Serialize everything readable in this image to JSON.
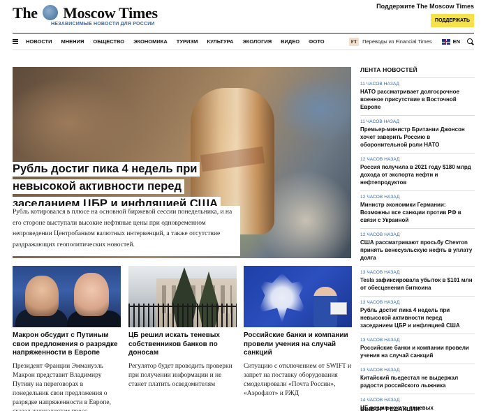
{
  "header": {
    "logo_text_left": "The",
    "logo_text_right": "Moscow Times",
    "logo_subtitle": "НЕЗАВИСИМЫЕ НОВОСТИ ДЛЯ РОССИИ",
    "support_title": "Поддержите The Moscow Times",
    "support_button": "ПОДДЕРЖАТЬ",
    "support_button_color": "#f5e14a"
  },
  "nav": {
    "items": [
      "НОВОСТИ",
      "МНЕНИЯ",
      "ОБЩЕСТВО",
      "ЭКОНОМИКА",
      "ТУРИЗМ",
      "КУЛЬТУРА",
      "ЭКОЛОГИЯ",
      "ВИДЕО",
      "ФОТО"
    ],
    "ft_badge": "FT",
    "ft_label": "Переводы из Financial Times",
    "lang": "EN"
  },
  "hero": {
    "title": "Рубль достиг пика 4 недель при невысокой активности перед заседанием ЦБР и инфляцией США",
    "lead": "Рубль котировался в плюсе на основной биржевой сессии понедельника, и на его стороне выступали высокие нефтяные цены при одновременном непроведении Центробанком валютных интервенций, а также отсутствие раздражающих геополитических новостей."
  },
  "cards": [
    {
      "title": "Макрон обсудит с Путиным свои предложения о разрядке напряженности в Европе",
      "lead": "Президент Франции Эммануэль Макрон представит Владимиру Путину на переговорах в понедельник свои предложения о разрядке напряженности в Европе, сказал журналистам пресс-"
    },
    {
      "title": "ЦБ решил искать теневых собственников банков по доносам",
      "lead": "Регулятор будет проводить проверки при получении информации и не станет платить осведомителям"
    },
    {
      "title": "Российские банки и компании провели учения на случай санкций",
      "lead": "Ситуацию с отключением от SWIFT и запрет на поставку оборудования смоделировали «Почта России», «Аэрофлот» и РЖД"
    }
  ],
  "sidebar": {
    "heading": "ЛЕНТА НОВОСТЕЙ",
    "accent_color": "#3569a8",
    "items": [
      {
        "time": "11 ЧАСОВ НАЗАД",
        "title": "НАТО рассматривает долгосрочное военное присутствие в Восточной Европе"
      },
      {
        "time": "11 ЧАСОВ НАЗАД",
        "title": "Премьер-министр Британии Джонсон хочет заверить Россию в оборонительной роли НАТО"
      },
      {
        "time": "12 ЧАСОВ НАЗАД",
        "title": "Россия получила в 2021 году $180 млрд дохода от экспорта нефти и нефтепродуктов"
      },
      {
        "time": "12 ЧАСОВ НАЗАД",
        "title": "Министр экономики Германии: Возможны все санкции против РФ в связи с Украиной"
      },
      {
        "time": "12 ЧАСОВ НАЗАД",
        "title": "США рассматривают просьбу Chevron принять венесуэльскую нефть в уплату долга"
      },
      {
        "time": "13 ЧАСОВ НАЗАД",
        "title": "Tesla зафиксировала убыток в $101 млн от обесценения биткоина"
      },
      {
        "time": "13 ЧАСОВ НАЗАД",
        "title": "Рубль достиг пика 4 недель при невысокой активности перед заседанием ЦБР и инфляцией США"
      },
      {
        "time": "13 ЧАСОВ НАЗАД",
        "title": "Российские банки и компании провели учения на случай санкций"
      },
      {
        "time": "13 ЧАСОВ НАЗАД",
        "title": "Китайский пьедестал не выдержал радости российского лыжника"
      },
      {
        "time": "14 ЧАСОВ НАЗАД",
        "title": "ЦБ решил искать теневых собственников банков по доносам"
      }
    ],
    "heading2": "ВЫБОР РЕДАКЦИИ"
  }
}
